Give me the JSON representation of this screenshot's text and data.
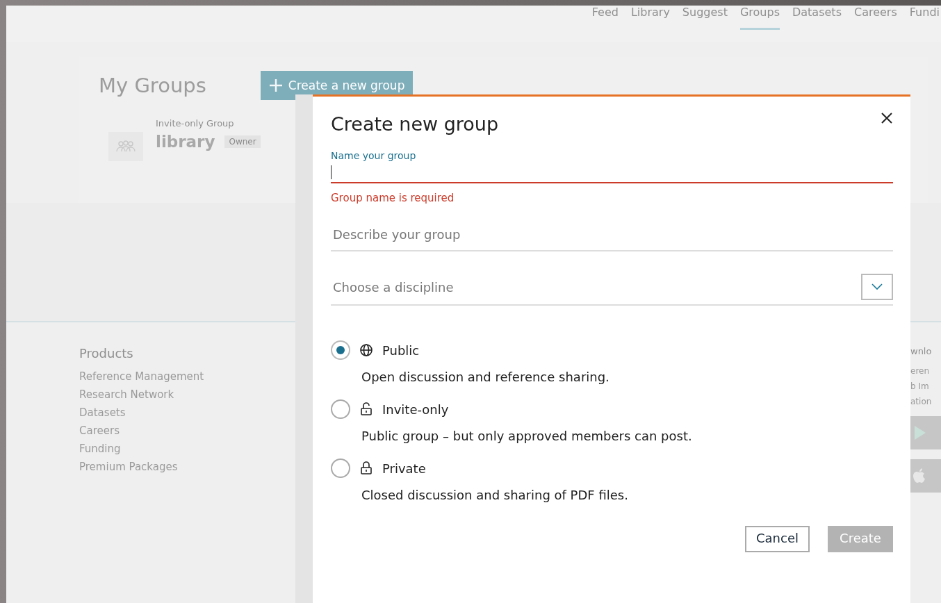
{
  "nav": [
    {
      "label": "Feed",
      "selected": false
    },
    {
      "label": "Library",
      "selected": false
    },
    {
      "label": "Suggest",
      "selected": false
    },
    {
      "label": "Groups",
      "selected": true
    },
    {
      "label": "Datasets",
      "selected": false
    },
    {
      "label": "Careers",
      "selected": false
    },
    {
      "label": "Fundi",
      "selected": false
    }
  ],
  "my_groups": {
    "title": "My Groups",
    "create_button": "Create a new group",
    "group": {
      "type_label": "Invite-only Group",
      "name": "library",
      "badge": "Owner"
    }
  },
  "footer": {
    "products": {
      "heading": "Products",
      "links": [
        "Reference Management",
        "Research Network",
        "Datasets",
        "Careers",
        "Funding",
        "Premium Packages"
      ]
    },
    "column_2": {
      "heading": "wnlo",
      "links": [
        "eren",
        "b Im",
        "ation"
      ]
    }
  },
  "dialog": {
    "title": "Create new group",
    "name_field": {
      "label": "Name your group",
      "error": "Group name is required"
    },
    "description_field": {
      "placeholder": "Describe your group"
    },
    "discipline_field": {
      "placeholder": "Choose a discipline"
    },
    "visibility": [
      {
        "kind": "globe",
        "label": "Public",
        "description": "Open discussion and reference sharing.",
        "selected": true
      },
      {
        "kind": "open-lock",
        "label": "Invite-only",
        "description": "Public group – but only approved members can post.",
        "selected": false
      },
      {
        "kind": "lock",
        "label": "Private",
        "description": "Closed discussion and sharing of PDF files.",
        "selected": false
      }
    ],
    "cancel_button": "Cancel",
    "create_button": {
      "label": "Create",
      "disabled": true
    }
  }
}
